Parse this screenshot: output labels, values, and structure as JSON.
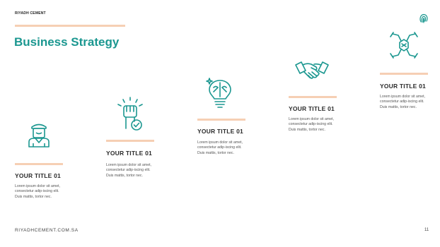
{
  "header": {
    "brand": "RIYADH CEMENT"
  },
  "slide": {
    "title": "Business Strategy"
  },
  "steps": [
    {
      "icon": "worker-icon",
      "title": "YOUR TITLE 01",
      "text": "Lorem ipsum dolor sit amet, consectetur adip-iscing elit. Duis mattis, tortor nec."
    },
    {
      "icon": "raised-fist-check-icon",
      "title": "YOUR TITLE 01",
      "text": "Lorem ipsum dolor sit amet, consectetur adip-iscing elit. Duis mattis, tortor nec."
    },
    {
      "icon": "brain-bulb-icon",
      "title": "YOUR TITLE 01",
      "text": "Lorem ipsum dolor sit amet, consectetur adip-iscing elit. Duis mattis, tortor nec."
    },
    {
      "icon": "handshake-icon",
      "title": "YOUR TITLE 01",
      "text": "Lorem ipsum dolor sit amet, consectetur adip-iscing elit. Duis mattis, tortor nec."
    },
    {
      "icon": "team-hands-icon",
      "title": "YOUR TITLE 01",
      "text": "Lorem ipsum dolor sit amet, consectetur adip-iscing elit. Duis mattis, tortor nec."
    }
  ],
  "footer": {
    "url": "RIYADHCEMENT.COM.SA",
    "page": "11"
  },
  "colors": {
    "accent": "#1b9790",
    "bar": "#f6cfb4",
    "text": "#2c2c2c"
  }
}
